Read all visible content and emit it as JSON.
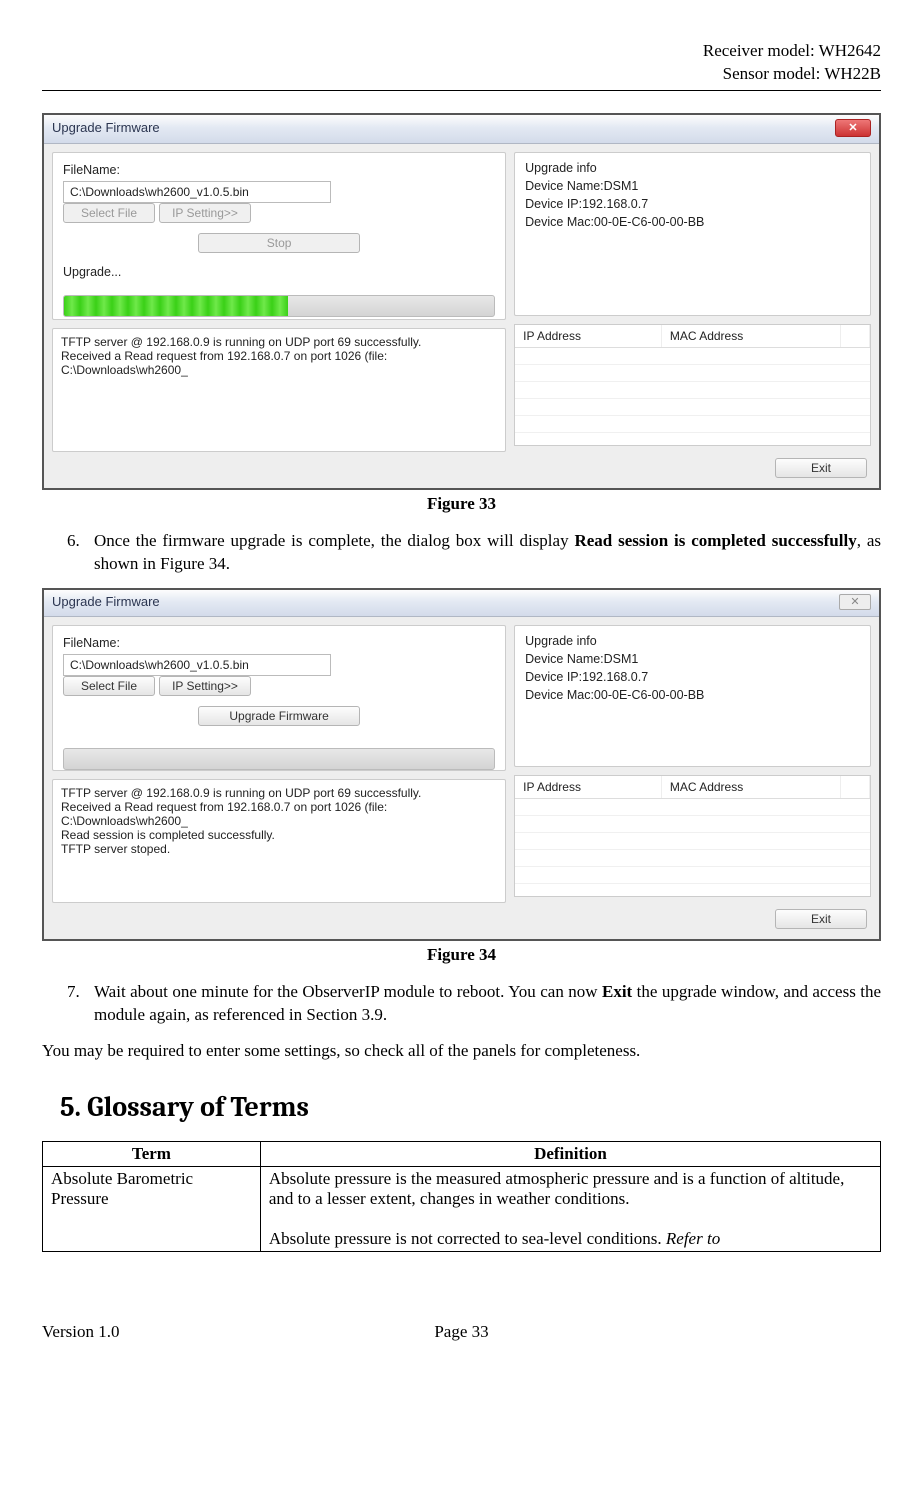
{
  "header": {
    "line1": "Receiver model: WH2642",
    "line2": "Sensor model: WH22B"
  },
  "fig33": {
    "title": "Upgrade Firmware",
    "filename_label": "FileName:",
    "filename_value": "C:\\Downloads\\wh2600_v1.0.5.bin",
    "select_file_btn": "Select File",
    "ip_setting_btn": "IP Setting>>",
    "stop_btn": "Stop",
    "upgrade_status": "Upgrade...",
    "log": "TFTP server @ 192.168.0.9 is running on UDP port 69 successfully.\nReceived a Read request from 192.168.0.7 on port 1026 (file: C:\\Downloads\\wh2600_",
    "info_title": "Upgrade info",
    "info_name": "Device Name:DSM1",
    "info_ip": "Device IP:192.168.0.7",
    "info_mac": "Device Mac:00-0E-C6-00-00-BB",
    "ip_col": "IP Address",
    "mac_col": "MAC Address",
    "exit_btn": "Exit",
    "caption": "Figure 33"
  },
  "step6": {
    "num": "6.",
    "pre": "Once the firmware upgrade is complete, the dialog box will display ",
    "bold": "Read session is completed successfully",
    "post": ", as shown in Figure 34."
  },
  "fig34": {
    "title": "Upgrade Firmware",
    "filename_label": "FileName:",
    "filename_value": "C:\\Downloads\\wh2600_v1.0.5.bin",
    "select_file_btn": "Select File",
    "ip_setting_btn": "IP Setting>>",
    "upgrade_btn": "Upgrade Firmware",
    "log": "TFTP server @ 192.168.0.9 is running on UDP port 69 successfully.\nReceived a Read request from 192.168.0.7 on port 1026 (file: C:\\Downloads\\wh2600_\nRead session is completed successfully.\nTFTP server stoped.",
    "info_title": "Upgrade info",
    "info_name": "Device Name:DSM1",
    "info_ip": "Device IP:192.168.0.7",
    "info_mac": "Device Mac:00-0E-C6-00-00-BB",
    "ip_col": "IP Address",
    "mac_col": "MAC Address",
    "exit_btn": "Exit",
    "caption": "Figure 34"
  },
  "step7": {
    "num": "7.",
    "pre": "Wait about one minute for the ObserverIP module to reboot. You can now ",
    "bold": "Exit",
    "post": " the upgrade window, and access the module again, as referenced in Section 3.9."
  },
  "note": "You may be required to enter some settings, so check all of the panels for completeness.",
  "section5": "5. Glossary of Terms",
  "glossary": {
    "h_term": "Term",
    "h_def": "Definition",
    "row1_term": "Absolute Barometric Pressure",
    "row1_def_p1": "Absolute pressure is the measured atmospheric pressure and is a function of altitude, and to a lesser extent, changes in weather conditions.",
    "row1_def_p2a": "Absolute pressure is not corrected to sea-level conditions. ",
    "row1_def_p2b": "Refer to"
  },
  "footer": {
    "version": "Version 1.0",
    "page": "Page 33"
  }
}
